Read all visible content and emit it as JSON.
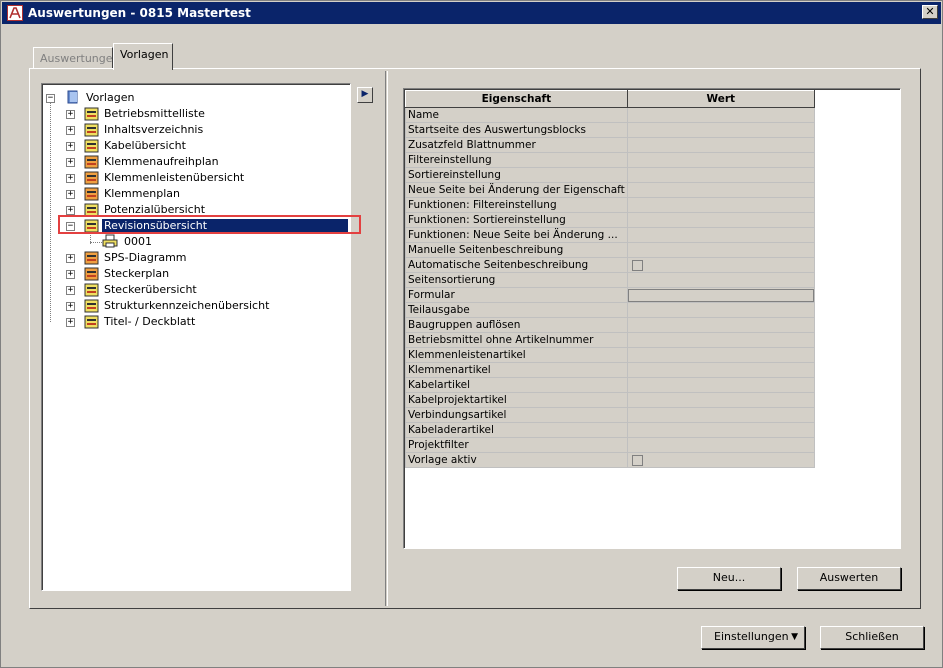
{
  "window": {
    "title": "Auswertungen - 0815 Mastertest",
    "close_label": "✕"
  },
  "tabs": [
    {
      "label": "Auswertungen",
      "active": false
    },
    {
      "label": "Vorlagen",
      "active": true
    }
  ],
  "tree": {
    "root": {
      "label": "Vorlagen",
      "icon": "book-icon"
    },
    "items": [
      {
        "label": "Betriebsmittelliste",
        "icon": "template-icon"
      },
      {
        "label": "Inhaltsverzeichnis",
        "icon": "template-icon"
      },
      {
        "label": "Kabelübersicht",
        "icon": "template-icon"
      },
      {
        "label": "Klemmenaufreihplan",
        "icon": "template-icon"
      },
      {
        "label": "Klemmenleistenübersicht",
        "icon": "template-icon"
      },
      {
        "label": "Klemmenplan",
        "icon": "template-icon"
      },
      {
        "label": "Potenzialübersicht",
        "icon": "template-icon"
      },
      {
        "label": "Revisionsübersicht",
        "icon": "template-icon",
        "selected": true,
        "expanded": true
      },
      {
        "label": "SPS-Diagramm",
        "icon": "template-icon"
      },
      {
        "label": "Steckerplan",
        "icon": "template-icon"
      },
      {
        "label": "Steckerübersicht",
        "icon": "template-icon"
      },
      {
        "label": "Strukturkennzeichenübersicht",
        "icon": "template-icon"
      },
      {
        "label": "Titel- / Deckblatt",
        "icon": "template-icon"
      }
    ],
    "child": {
      "label": "0001",
      "icon": "printer-icon"
    }
  },
  "arrow_button": "▶",
  "grid": {
    "headers": {
      "property": "Eigenschaft",
      "value": "Wert"
    },
    "rows": [
      {
        "property": "Name",
        "value": "",
        "type": "text"
      },
      {
        "property": "Startseite des Auswertungsblocks",
        "value": "",
        "type": "text"
      },
      {
        "property": "Zusatzfeld Blattnummer",
        "value": "",
        "type": "text"
      },
      {
        "property": "Filtereinstellung",
        "value": "",
        "type": "text"
      },
      {
        "property": "Sortiereinstellung",
        "value": "",
        "type": "text"
      },
      {
        "property": "Neue Seite bei Änderung der Eigenschaft",
        "value": "",
        "type": "text"
      },
      {
        "property": "Funktionen: Filtereinstellung",
        "value": "",
        "type": "text"
      },
      {
        "property": "Funktionen: Sortiereinstellung",
        "value": "",
        "type": "text"
      },
      {
        "property": "Funktionen: Neue Seite bei Änderung ...",
        "value": "",
        "type": "text"
      },
      {
        "property": "Manuelle Seitenbeschreibung",
        "value": "",
        "type": "text"
      },
      {
        "property": "Automatische Seitenbeschreibung",
        "value": "",
        "type": "checkbox"
      },
      {
        "property": "Seitensortierung",
        "value": "",
        "type": "text"
      },
      {
        "property": "Formular",
        "value": "",
        "type": "field"
      },
      {
        "property": "Teilausgabe",
        "value": "",
        "type": "text"
      },
      {
        "property": "Baugruppen auflösen",
        "value": "",
        "type": "text"
      },
      {
        "property": "Betriebsmittel ohne Artikelnummer",
        "value": "",
        "type": "text"
      },
      {
        "property": "Klemmenleistenartikel",
        "value": "",
        "type": "text"
      },
      {
        "property": "Klemmenartikel",
        "value": "",
        "type": "text"
      },
      {
        "property": "Kabelartikel",
        "value": "",
        "type": "text"
      },
      {
        "property": "Kabelprojektartikel",
        "value": "",
        "type": "text"
      },
      {
        "property": "Verbindungsartikel",
        "value": "",
        "type": "text"
      },
      {
        "property": "Kabeladerartikel",
        "value": "",
        "type": "text"
      },
      {
        "property": "Projektfilter",
        "value": "",
        "type": "text"
      },
      {
        "property": "Vorlage aktiv",
        "value": "",
        "type": "checkbox"
      }
    ]
  },
  "buttons": {
    "new": "Neu...",
    "evaluate": "Auswerten",
    "settings": "Einstellungen",
    "settings_arrow": "▼",
    "close": "Schließen"
  }
}
